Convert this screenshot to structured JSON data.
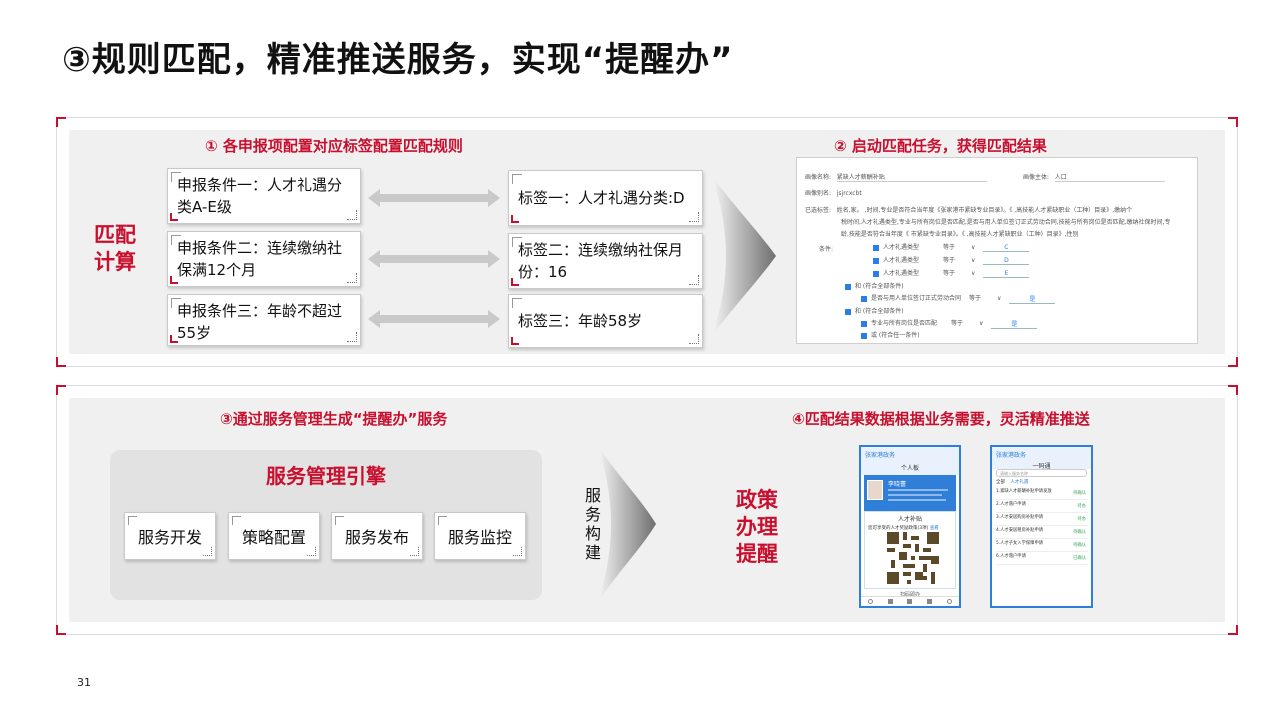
{
  "page": {
    "title": "③规则匹配，精准推送服务，实现“提醒办”",
    "page_number": "31"
  },
  "section1": {
    "side_label_line1": "匹配",
    "side_label_line2": "计算",
    "heading_left": "① 各申报项配置对应标签配置匹配规则",
    "heading_right": "② 启动匹配任务，获得匹配结果",
    "conditions": [
      {
        "line1": "申报条件一：人才礼遇分",
        "line2": "类A-E级"
      },
      {
        "line1": "申报条件二：连续缴纳社",
        "line2": "保满12个月"
      },
      {
        "line1": "申报条件三：年龄不超过",
        "line2": "55岁"
      }
    ],
    "tags": [
      {
        "line1": "标签一：人才礼遇分类:D",
        "line2": ""
      },
      {
        "line1": "标签二：连续缴纳社保月",
        "line2": "份：16"
      },
      {
        "line1": "标签三：年龄58岁",
        "line2": ""
      }
    ],
    "form": {
      "row1_label": "画像名称:",
      "row1_value": "紧缺人才薪酬补贴",
      "row1_label2": "画像主体:",
      "row1_value2": "人口",
      "row2_label": "画像别名:",
      "row2_value": "jsjrcxcbt",
      "row3_label": "已选标签:",
      "row3_text1": "姓名,家。    ,时间,专业是否符合当年度《张家港市紧缺专业目录》。《        ,高技能人才紧缺职业（工种）目录》,缴纳个",
      "row3_text2": "税时间,人才礼遇类型,专业与所有岗位是否匹配,是否与用人单位签订正式劳动合同,技能与所有岗位是否匹配,缴纳社保时间,专",
      "row3_text3": "龄,技能是否符合当年度《        市紧缺专业目录》。《        ,高技能人才紧缺职业（工种）目录》,性别",
      "cond_label": "条件:",
      "cond_rows": [
        {
          "field": "人才礼遇类型",
          "op": "等于",
          "val": "C"
        },
        {
          "field": "人才礼遇类型",
          "op": "等于",
          "val": "D"
        },
        {
          "field": "人才礼遇类型",
          "op": "等于",
          "val": "E"
        }
      ],
      "group1": "和 (符合全部条件)",
      "group1_row": {
        "field": "是否与用人单位签订正式劳动合同",
        "op": "等于",
        "val": "是"
      },
      "group2": "和 (符合全部条件)",
      "group2_row": {
        "field": "专业与所有岗位是否匹配",
        "op": "等于",
        "val": "是"
      },
      "group3": "或 (符合任一条件)"
    }
  },
  "section2": {
    "heading_left": "③通过服务管理生成“提醒办”服务",
    "heading_right": "④匹配结果数据根据业务需要，灵活精准推送",
    "engine_title": "服务管理引擎",
    "engine_buttons": [
      "服务开发",
      "策略配置",
      "服务发布",
      "服务监控"
    ],
    "build_label": [
      "服",
      "务",
      "构",
      "建"
    ],
    "policy_line1": "政策",
    "policy_line2": "办理",
    "policy_line3": "提醒",
    "phone1": {
      "brand": "张家港政务",
      "header": "个人板",
      "name": "李晓蕾",
      "card_title": "人才补贴",
      "notice": "您可享受的人才奖励政策(3项)",
      "notice_link": "查看",
      "footer": "扫码即办"
    },
    "phone2": {
      "brand": "张家港政务",
      "header": "一码通",
      "search_placeholder": "请输入服务名称",
      "tab1": "全部",
      "tab2": "人才礼遇",
      "items": [
        {
          "text": "1.紧缺人才薪酬补贴申请发放",
          "status": "待确认"
        },
        {
          "text": "2.人才落户申请",
          "status": "待办"
        },
        {
          "text": "3.人才安居购房补贴申请",
          "status": "待办"
        },
        {
          "text": "4.人才安居租房补贴申请",
          "status": "待确认"
        },
        {
          "text": "5.人才子女入学保障申请",
          "status": "待确认"
        },
        {
          "text": "6.人才落户申请",
          "status": "已确认"
        }
      ]
    }
  },
  "colors": {
    "accent": "#c8102e",
    "panel_bg": "#f0f0f0",
    "phone_blue": "#2f7ed8"
  }
}
